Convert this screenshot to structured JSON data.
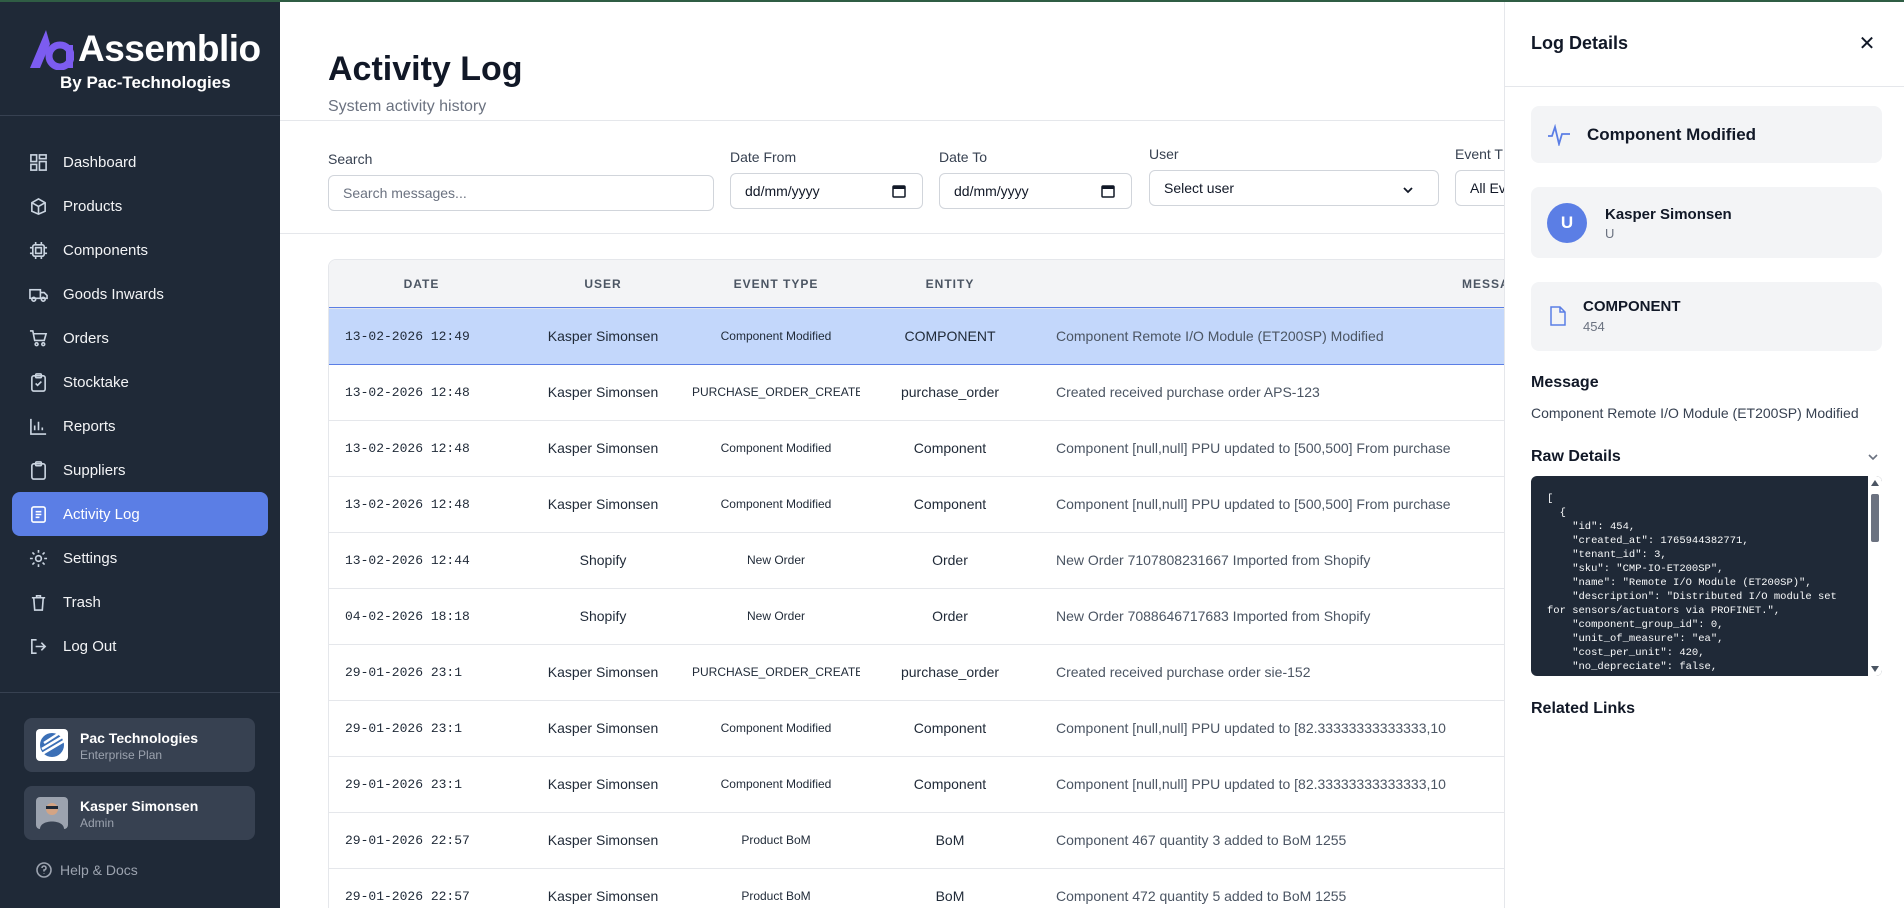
{
  "brand": {
    "name": "Assemblio",
    "sub": "By Pac-Technologies"
  },
  "sidebar": {
    "items": [
      {
        "label": "Dashboard",
        "icon": "dashboard-icon"
      },
      {
        "label": "Products",
        "icon": "package-icon"
      },
      {
        "label": "Components",
        "icon": "chip-icon"
      },
      {
        "label": "Goods Inwards",
        "icon": "truck-icon"
      },
      {
        "label": "Orders",
        "icon": "cart-icon"
      },
      {
        "label": "Stocktake",
        "icon": "clipboard-check-icon"
      },
      {
        "label": "Reports",
        "icon": "bar-chart-icon"
      },
      {
        "label": "Suppliers",
        "icon": "clipboard-icon"
      },
      {
        "label": "Activity Log",
        "icon": "activity-log-icon",
        "active": true
      },
      {
        "label": "Settings",
        "icon": "gear-icon"
      },
      {
        "label": "Trash",
        "icon": "trash-icon"
      },
      {
        "label": "Log Out",
        "icon": "logout-icon"
      }
    ],
    "org": {
      "name": "Pac Technologies",
      "plan": "Enterprise Plan"
    },
    "user": {
      "name": "Kasper Simonsen",
      "role": "Admin"
    },
    "help": "Help & Docs"
  },
  "header": {
    "title": "Activity Log",
    "subtitle": "System activity history"
  },
  "filters": {
    "search_label": "Search",
    "search_placeholder": "Search messages...",
    "date_from_label": "Date From",
    "date_from_value": "dd/mm/yyyy",
    "date_to_label": "Date To",
    "date_to_value": "dd/mm/yyyy",
    "user_label": "User",
    "user_value": "Select user",
    "event_label": "Event T",
    "event_value": "All Ev"
  },
  "table": {
    "columns": [
      "DATE",
      "USER",
      "EVENT TYPE",
      "ENTITY",
      "MESSAGE"
    ],
    "rows": [
      {
        "date": "13-02-2026 12:49",
        "user": "Kasper Simonsen",
        "event": "Component Modified",
        "entity": "COMPONENT",
        "message": "Component Remote I/O Module (ET200SP) Modified"
      },
      {
        "date": "13-02-2026 12:48",
        "user": "Kasper Simonsen",
        "event": "PURCHASE_ORDER_CREATED",
        "entity": "purchase_order",
        "message": "Created received purchase order APS-123"
      },
      {
        "date": "13-02-2026 12:48",
        "user": "Kasper Simonsen",
        "event": "Component Modified",
        "entity": "Component",
        "message": "Component [null,null] PPU updated to [500,500] From purchase"
      },
      {
        "date": "13-02-2026 12:48",
        "user": "Kasper Simonsen",
        "event": "Component Modified",
        "entity": "Component",
        "message": "Component [null,null] PPU updated to [500,500] From purchase"
      },
      {
        "date": "13-02-2026 12:44",
        "user": "Shopify",
        "event": "New Order",
        "entity": "Order",
        "message": "New Order 7107808231667 Imported from Shopify"
      },
      {
        "date": "04-02-2026 18:18",
        "user": "Shopify",
        "event": "New Order",
        "entity": "Order",
        "message": "New Order 7088646717683 Imported from Shopify"
      },
      {
        "date": "29-01-2026 23:1",
        "user": "Kasper Simonsen",
        "event": "PURCHASE_ORDER_CREATED",
        "entity": "purchase_order",
        "message": "Created received purchase order sie-152"
      },
      {
        "date": "29-01-2026 23:1",
        "user": "Kasper Simonsen",
        "event": "Component Modified",
        "entity": "Component",
        "message": "Component [null,null] PPU updated to [82.33333333333333,10"
      },
      {
        "date": "29-01-2026 23:1",
        "user": "Kasper Simonsen",
        "event": "Component Modified",
        "entity": "Component",
        "message": "Component [null,null] PPU updated to [82.33333333333333,10"
      },
      {
        "date": "29-01-2026 22:57",
        "user": "Kasper Simonsen",
        "event": "Product BoM",
        "entity": "BoM",
        "message": "Component 467 quantity 3 added to BoM 1255"
      },
      {
        "date": "29-01-2026 22:57",
        "user": "Kasper Simonsen",
        "event": "Product BoM",
        "entity": "BoM",
        "message": "Component 472 quantity 5 added to BoM 1255"
      }
    ]
  },
  "panel": {
    "title": "Log Details",
    "event_title": "Component Modified",
    "user_initial": "U",
    "user_name": "Kasper Simonsen",
    "user_sub": "U",
    "entity_name": "COMPONENT",
    "entity_id": "454",
    "message_heading": "Message",
    "message_text": "Component Remote I/O Module (ET200SP) Modified",
    "raw_heading": "Raw Details",
    "raw_text": "[\n  {\n    \"id\": 454,\n    \"created_at\": 1765944382771,\n    \"tenant_id\": 3,\n    \"sku\": \"CMP-IO-ET200SP\",\n    \"name\": \"Remote I/O Module (ET200SP)\",\n    \"description\": \"Distributed I/O module set\nfor sensors/actuators via PROFINET.\",\n    \"component_group_id\": 0,\n    \"unit_of_measure\": \"ea\",\n    \"cost_per_unit\": 420,\n    \"no_depreciate\": false,",
    "related_heading": "Related Links"
  },
  "colors": {
    "sidebar": "#1f2937",
    "accent": "#5b7ee5",
    "selected_row": "#c3d7fb"
  }
}
